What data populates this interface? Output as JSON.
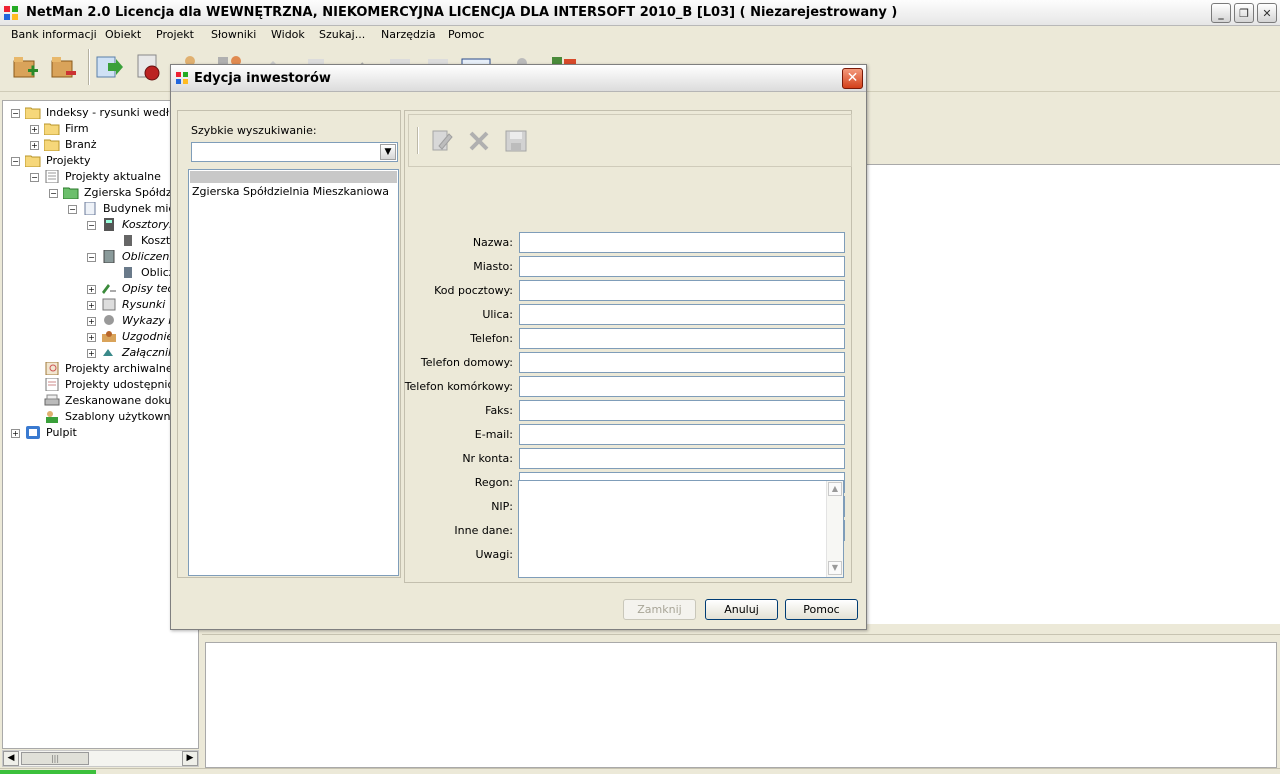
{
  "window": {
    "title": "NetMan 2.0 Licencja dla WEWNĘTRZNA, NIEKOMERCYJNA LICENCJA DLA INTERSOFT 2010_B [L03] ( Niezarejestrowany )",
    "minimize": "_",
    "restore": "❐",
    "close": "✕"
  },
  "menu": {
    "items": [
      "Bank informacji",
      "Obiekt",
      "Projekt",
      "Słowniki",
      "Widok",
      "Szukaj...",
      "Narzędzia",
      "Pomoc"
    ]
  },
  "tree": {
    "nodes": [
      {
        "label": "Indeksy - rysunki według",
        "exp": "−"
      },
      {
        "label": "Firm",
        "exp": "+"
      },
      {
        "label": "Branż",
        "exp": "+"
      },
      {
        "label": "Projekty",
        "exp": "−"
      },
      {
        "label": "Projekty aktualne",
        "exp": "−"
      },
      {
        "label": "Zgierska Spółdzie",
        "exp": "−"
      },
      {
        "label": "Budynek mies",
        "exp": "−"
      },
      {
        "label": "Kosztorys",
        "exp": "−"
      },
      {
        "label": "Koszt",
        "exp": ""
      },
      {
        "label": "Obliczenia",
        "exp": "−"
      },
      {
        "label": "Oblicz",
        "exp": ""
      },
      {
        "label": "Opisy tec",
        "exp": "+"
      },
      {
        "label": "Rysunki",
        "exp": "+"
      },
      {
        "label": "Wykazy n",
        "exp": "+"
      },
      {
        "label": "Uzgodnie",
        "exp": "+"
      },
      {
        "label": "Załącznik",
        "exp": "+"
      },
      {
        "label": "Projekty archiwalne",
        "exp": ""
      },
      {
        "label": "Projekty udostępnione",
        "exp": ""
      },
      {
        "label": "Zeskanowane dokum",
        "exp": ""
      },
      {
        "label": "Szablony użytkownika",
        "exp": ""
      },
      {
        "label": "Pulpit",
        "exp": "+"
      }
    ],
    "scroll_thumb": "|||"
  },
  "dialog": {
    "title": "Edycja inwestorów",
    "close": "✕",
    "quick_search_label": "Szybkie wyszukiwanie:",
    "quick_search_value": "",
    "list_items": [
      "Zgierska Spółdzielnia Mieszkaniowa"
    ],
    "fields": [
      {
        "label": "Nazwa:",
        "value": ""
      },
      {
        "label": "Miasto:",
        "value": ""
      },
      {
        "label": "Kod pocztowy:",
        "value": ""
      },
      {
        "label": "Ulica:",
        "value": ""
      },
      {
        "label": "Telefon:",
        "value": ""
      },
      {
        "label": "Telefon domowy:",
        "value": ""
      },
      {
        "label": "Telefon komórkowy:",
        "value": ""
      },
      {
        "label": "Faks:",
        "value": ""
      },
      {
        "label": "E-mail:",
        "value": ""
      },
      {
        "label": "Nr konta:",
        "value": ""
      },
      {
        "label": "Regon:",
        "value": ""
      },
      {
        "label": "NIP:",
        "value": ""
      },
      {
        "label": "Inne dane:",
        "value": ""
      }
    ],
    "notes_label": "Uwagi:",
    "notes_value": "",
    "buttons": {
      "close": "Zamknij",
      "cancel": "Anuluj",
      "help": "Pomoc"
    }
  },
  "colors": {
    "accent": "#003c74",
    "close_red": "#d3401a",
    "status_green": "#3cc03c"
  }
}
